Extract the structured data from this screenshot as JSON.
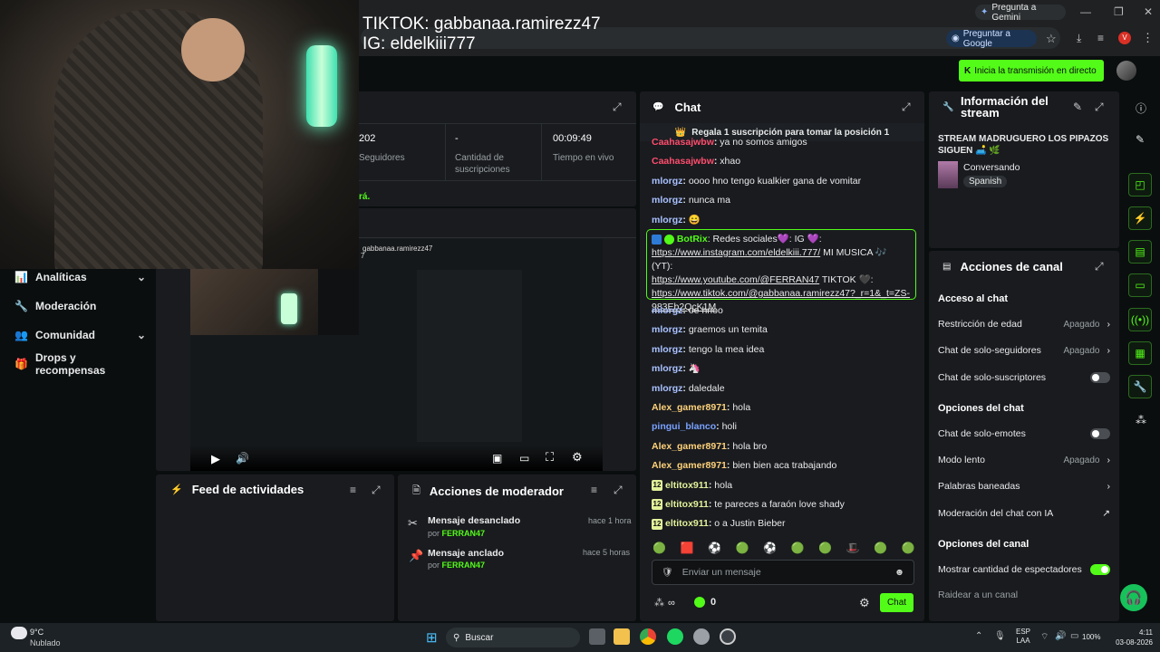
{
  "browser": {
    "gemini_label": "Pregunta a Gemini",
    "ask_google_label": "Preguntar a Google",
    "profile_initial": "V"
  },
  "overlay": {
    "line1": "TIKTOK: gabbanaa.ramirezz47",
    "line2": "IG: eldelkiii777"
  },
  "header": {
    "go_live_label": "Inicia la transmisión en directo"
  },
  "nav": {
    "items": [
      {
        "label": "Analíticas",
        "icon": "chart-icon",
        "has_chevron": true
      },
      {
        "label": "Moderación",
        "icon": "wrench-icon",
        "has_chevron": false
      },
      {
        "label": "Comunidad",
        "icon": "people-icon",
        "has_chevron": true
      },
      {
        "label": "Drops y recompensas",
        "icon": "gift-icon",
        "has_chevron": false
      }
    ]
  },
  "stats": {
    "followers_value": "202",
    "followers_label": "Seguidores",
    "subs_value": "-",
    "subs_label_1": "Cantidad de",
    "subs_label_2": "suscripciones",
    "time_value": "00:09:49",
    "time_label": "Tiempo en vivo",
    "notice_fragment": "rá."
  },
  "preview": {
    "inner_text_1": "gabbanaa.ramirezz47",
    "inner_text_2": "7"
  },
  "feed": {
    "title": "Feed de actividades"
  },
  "mod_actions": {
    "title": "Acciones de moderador",
    "items": [
      {
        "action": "Mensaje desanclado",
        "by_prefix": "por",
        "by": "FERRAN47",
        "time": "hace 1 hora",
        "icon": "unpin-icon"
      },
      {
        "action": "Mensaje anclado",
        "by_prefix": "por",
        "by": "FERRAN47",
        "time": "hace 5 horas",
        "icon": "pin-icon"
      }
    ]
  },
  "chat": {
    "title": "Chat",
    "gift_banner": "Regala 1 suscripción para tomar la posición 1",
    "messages": [
      {
        "user": "Caahasajwbw",
        "text": "ya no somos amigos",
        "color": "#ff4d6d",
        "badge": ""
      },
      {
        "user": "Caahasajwbw",
        "text": "xhao",
        "color": "#ff4d6d",
        "badge": ""
      },
      {
        "user": "mlorgz",
        "text": "oooo hno tengo kualkier gana de vomitar",
        "color": "#a9c1ff",
        "badge": ""
      },
      {
        "user": "mlorgz",
        "text": "nunca ma",
        "color": "#a9c1ff",
        "badge": ""
      },
      {
        "user": "mlorgz",
        "text": "😄",
        "color": "#a9c1ff",
        "badge": ""
      }
    ],
    "botrix": {
      "user": "BotRix",
      "line1": "Redes sociales💜: IG 💜:",
      "line2a": "https://www.instagram.com/eldelkiii.777/",
      "line2b": " MI MUSICA 🎶 (YT):",
      "line3a": "https://www.youtube.com/@FERRAN47",
      "line3b": " TIKTOK 🖤:",
      "line4": "https://www.tiktok.com/@gabbanaa.ramirezz47?_r=1&_t=ZS-",
      "line5": "983Eb2QcK1M"
    },
    "messages2": [
      {
        "user": "mlorgz",
        "text": "oe hnoo",
        "color": "#a9c1ff",
        "badge": ""
      },
      {
        "user": "mlorgz",
        "text": "graemos un temita",
        "color": "#a9c1ff",
        "badge": ""
      },
      {
        "user": "mlorgz",
        "text": "tengo la mea idea",
        "color": "#a9c1ff",
        "badge": ""
      },
      {
        "user": "mlorgz",
        "text": "🦄",
        "color": "#a9c1ff",
        "badge": ""
      },
      {
        "user": "mlorgz",
        "text": "daledale",
        "color": "#a9c1ff",
        "badge": ""
      },
      {
        "user": "Alex_gamer8971",
        "text": "hola",
        "color": "#ffd27a",
        "badge": ""
      },
      {
        "user": "pingui_blanco",
        "text": "holi",
        "color": "#7aa2ff",
        "badge": ""
      },
      {
        "user": "Alex_gamer8971",
        "text": "hola bro",
        "color": "#ffd27a",
        "badge": ""
      },
      {
        "user": "Alex_gamer8971",
        "text": "bien bien aca trabajando",
        "color": "#ffd27a",
        "badge": ""
      },
      {
        "user": "eltitox911",
        "text": "hola",
        "color": "#e2f19a",
        "badge": "12"
      },
      {
        "user": "eltitox911",
        "text": "te pareces a faraón love shady",
        "color": "#e2f19a",
        "badge": "12"
      },
      {
        "user": "eltitox911",
        "text": "o a Justin Bieber",
        "color": "#e2f19a",
        "badge": "12"
      }
    ],
    "emotes": [
      "🟢",
      "🟥",
      "⚽",
      "🟢",
      "⚽",
      "🟢",
      "🟢",
      "🎩",
      "🟢",
      "🟢"
    ],
    "input_placeholder": "Enviar un mensaje",
    "points_label": "∞",
    "kick_count": "0",
    "send_label": "Chat"
  },
  "info": {
    "title_1": "Información del",
    "title_2": "stream",
    "stream_title": "STREAM MADRUGUERO LOS PIPAZOS SIGUEN 🛋️ 🌿",
    "category": "Conversando",
    "language": "Spanish"
  },
  "channel_actions": {
    "title": "Acciones de canal",
    "chat_access_heading": "Acceso al chat",
    "age_restriction": "Restricción de edad",
    "age_restriction_value": "Apagado",
    "followers_only": "Chat de solo-seguidores",
    "followers_only_value": "Apagado",
    "subs_only": "Chat de solo-suscriptores",
    "chat_options_heading": "Opciones del chat",
    "emotes_only": "Chat de solo-emotes",
    "slow_mode": "Modo lento",
    "slow_mode_value": "Apagado",
    "banned_words": "Palabras baneadas",
    "ai_moderation": "Moderación del chat con IA",
    "channel_options_heading": "Opciones del canal",
    "show_viewers": "Mostrar cantidad de espectadores",
    "raid": "Raidear a un canal"
  },
  "taskbar": {
    "temp": "9°C",
    "weather": "Nublado",
    "search_label": "Buscar",
    "lang_1": "ESP",
    "lang_2": "LAA",
    "battery": "100%",
    "time": "4:11",
    "date": "03-08-2026"
  },
  "colors": {
    "accent": "#53fc18",
    "panel": "#191b1f",
    "background": "#0b0e0f"
  }
}
